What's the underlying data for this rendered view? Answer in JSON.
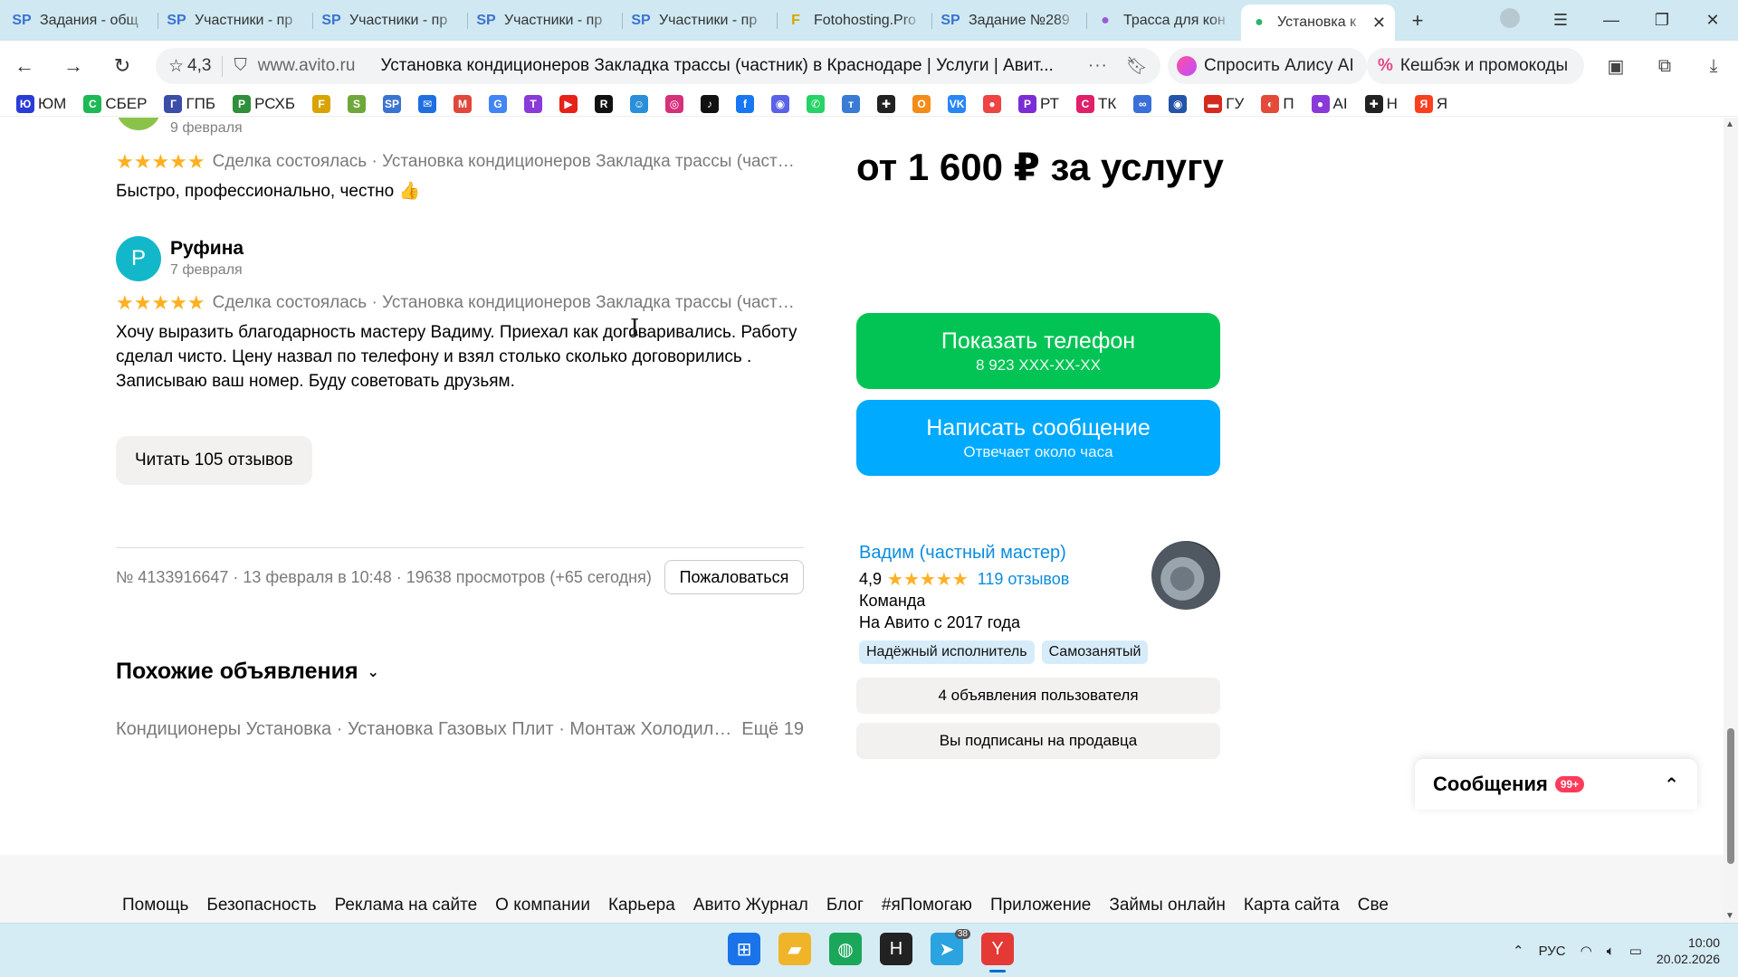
{
  "browser": {
    "tabs": [
      {
        "icon": "SP",
        "icon_color": "#3b73d1",
        "title": "Задания - общ"
      },
      {
        "icon": "SP",
        "icon_color": "#3b73d1",
        "title": "Участники - пр"
      },
      {
        "icon": "SP",
        "icon_color": "#3b73d1",
        "title": "Участники - пр"
      },
      {
        "icon": "SP",
        "icon_color": "#3b73d1",
        "title": "Участники - пр"
      },
      {
        "icon": "SP",
        "icon_color": "#3b73d1",
        "title": "Участники - пр"
      },
      {
        "icon": "F",
        "icon_color": "#d9a400",
        "title": "Fotohosting.Pro"
      },
      {
        "icon": "SP",
        "icon_color": "#3b73d1",
        "title": "Задание №289"
      },
      {
        "icon": "●",
        "icon_color": "#9b59d6",
        "title": "Трасса для кон"
      },
      {
        "icon": "●",
        "icon_color": "#2bb36b",
        "title": "Установка к",
        "active": true
      }
    ],
    "close_glyph": "✕",
    "new_tab_glyph": "+",
    "window_controls": [
      "☰",
      "—",
      "❐",
      "✕"
    ],
    "address": {
      "rating": "4,3",
      "domain": "www.avito.ru",
      "title": "Установка кондиционеров Закладка трассы (частник) в Краснодаре | Услуги | Авит...",
      "more": "···"
    },
    "alice_label": "Спросить Алису AI",
    "cashback_label": "Кешбэк и промокоды",
    "bookmarks": [
      {
        "icon": "Ю",
        "color": "#2a3bd8",
        "label": "ЮМ"
      },
      {
        "icon": "С",
        "color": "#1db954",
        "label": "СБЕР"
      },
      {
        "icon": "Г",
        "color": "#3a4ea8",
        "label": "ГПБ"
      },
      {
        "icon": "Р",
        "color": "#2f8f3a",
        "label": "РСХБ"
      },
      {
        "icon": "F",
        "color": "#d9a400",
        "label": ""
      },
      {
        "icon": "S",
        "color": "#6fa83a",
        "label": ""
      },
      {
        "icon": "SP",
        "color": "#3b73d1",
        "label": ""
      },
      {
        "icon": "✉",
        "color": "#1f6fe0",
        "label": ""
      },
      {
        "icon": "M",
        "color": "#e0483b",
        "label": ""
      },
      {
        "icon": "G",
        "color": "#4285f4",
        "label": ""
      },
      {
        "icon": "T",
        "color": "#8a3ad8",
        "label": ""
      },
      {
        "icon": "▶",
        "color": "#e62117",
        "label": ""
      },
      {
        "icon": "R",
        "color": "#111111",
        "label": ""
      },
      {
        "icon": "☺",
        "color": "#2a8fd8",
        "label": ""
      },
      {
        "icon": "◎",
        "color": "#d6307a",
        "label": ""
      },
      {
        "icon": "♪",
        "color": "#111111",
        "label": ""
      },
      {
        "icon": "f",
        "color": "#1877f2",
        "label": ""
      },
      {
        "icon": "◉",
        "color": "#5a62e8",
        "label": ""
      },
      {
        "icon": "✆",
        "color": "#25d366",
        "label": ""
      },
      {
        "icon": "т",
        "color": "#3a7bd5",
        "label": ""
      },
      {
        "icon": "✚",
        "color": "#222222",
        "label": ""
      },
      {
        "icon": "О",
        "color": "#f28c1a",
        "label": ""
      },
      {
        "icon": "VK",
        "color": "#2787f5",
        "label": ""
      },
      {
        "icon": "●",
        "color": "#ee4444",
        "label": ""
      },
      {
        "icon": "Р",
        "color": "#7b2cd6",
        "label": "РТ"
      },
      {
        "icon": "С",
        "color": "#e0206a",
        "label": "ТК"
      },
      {
        "icon": "∞",
        "color": "#3a6fd8",
        "label": ""
      },
      {
        "icon": "◉",
        "color": "#2453a8",
        "label": ""
      },
      {
        "icon": "▬",
        "color": "#d52b1e",
        "label": "ГУ"
      },
      {
        "icon": "◐",
        "color": "#e44a3a",
        "label": "П"
      },
      {
        "icon": "●",
        "color": "#8a3ad8",
        "label": "AI"
      },
      {
        "icon": "✚",
        "color": "#222222",
        "label": "Н"
      },
      {
        "icon": "Я",
        "color": "#fc3f1d",
        "label": "Я"
      }
    ]
  },
  "reviews": [
    {
      "initial": "",
      "avatar_color": "#8bc34a",
      "name": "",
      "date": "9 февраля",
      "stars": "★★★★★",
      "meta": "Сделка состоялась · Установка кондиционеров Закладка трассы (частник)",
      "text": "Быстро, профессионально, честно 👍"
    },
    {
      "initial": "Р",
      "avatar_color": "#12b8c9",
      "name": "Руфина",
      "date": "7 февраля",
      "stars": "★★★★★",
      "meta": "Сделка состоялась · Установка кондиционеров Закладка трассы (частник)",
      "text": "Хочу выразить благодарность мастеру Вадиму. Приехал как договаривались. Работу сделал чисто. Цену назвал по телефону и взял столько сколько договорились . Записываю ваш номер. Буду советовать друзьям."
    }
  ],
  "read_reviews_label": "Читать 105 отзывов",
  "ad_meta": "№ 4133916647 · 13 февраля в 10:48 · 19638 просмотров (+65 сегодня)",
  "complain_label": "Пожаловаться",
  "similar_title": "Похожие объявления",
  "similar_chevron": "⌄",
  "categories_text": "Кондиционеры Установка · Установка Газовых Плит · Монтаж Холодильного оборудования",
  "categories_more": "Ещё 19",
  "price": "от 1 600 ₽ за услугу",
  "phone_button": {
    "label": "Показать телефон",
    "sub": "8 923 XXX-XX-XX"
  },
  "message_button": {
    "label": "Написать сообщение",
    "sub": "Отвечает около часа"
  },
  "seller": {
    "name": "Вадим (частный мастер)",
    "rating": "4,9",
    "stars": "★★★★★",
    "reviews": "119 отзывов",
    "type": "Команда",
    "since": "На Авито с 2017 года",
    "badges": [
      "Надёжный исполнитель",
      "Самозанятый"
    ],
    "ads_button": "4 объявления пользователя",
    "subscribed_button": "Вы подписаны на продавца"
  },
  "footer_links": [
    "Помощь",
    "Безопасность",
    "Реклама на сайте",
    "О компании",
    "Карьера",
    "Авито Журнал",
    "Блог",
    "#яПомогаю",
    "Приложение",
    "Займы онлайн",
    "Карта сайта",
    "Све"
  ],
  "messages": {
    "title": "Сообщения",
    "badge": "99+",
    "chevron": "⌃"
  },
  "taskbar": {
    "apps": [
      {
        "name": "windows-start",
        "glyph": "⊞",
        "color": "#1a73e8"
      },
      {
        "name": "file-explorer",
        "glyph": "▰",
        "color": "#f0b429"
      },
      {
        "name": "edge",
        "glyph": "◍",
        "color": "#1aa75a"
      },
      {
        "name": "app-h",
        "glyph": "H",
        "color": "#222222"
      },
      {
        "name": "telegram",
        "glyph": "➤",
        "color": "#2aa3e0",
        "badge": "38"
      },
      {
        "name": "yandex-browser",
        "glyph": "Y",
        "color": "#e53935",
        "active": true
      }
    ],
    "lang": "РУС",
    "time": "10:00",
    "date": "20.02.2026"
  },
  "colors": {
    "accent_blue": "#0a8ddf",
    "green_button": "#02c454",
    "blue_button": "#00aaff",
    "star": "#ffb021"
  }
}
